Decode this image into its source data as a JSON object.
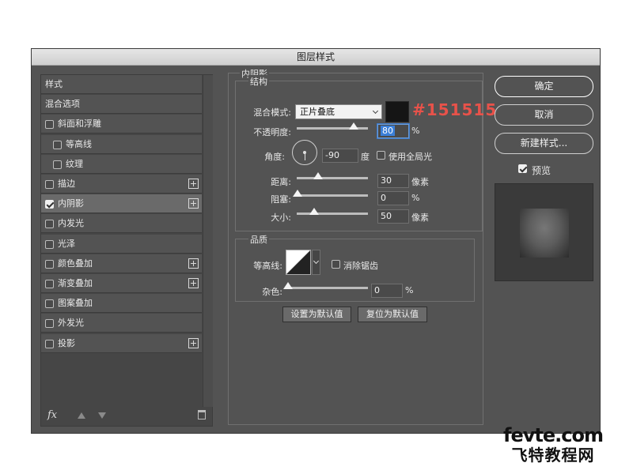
{
  "dialog": {
    "title": "图层样式"
  },
  "styles_list": {
    "items": [
      {
        "label": "样式",
        "checkbox": false,
        "checked": false,
        "plus": false,
        "indent": 0
      },
      {
        "label": "混合选项",
        "checkbox": false,
        "checked": false,
        "plus": false,
        "indent": 0
      },
      {
        "label": "斜面和浮雕",
        "checkbox": true,
        "checked": false,
        "plus": false,
        "indent": 0
      },
      {
        "label": "等高线",
        "checkbox": true,
        "checked": false,
        "plus": false,
        "indent": 1
      },
      {
        "label": "纹理",
        "checkbox": true,
        "checked": false,
        "plus": false,
        "indent": 1
      },
      {
        "label": "描边",
        "checkbox": true,
        "checked": false,
        "plus": true,
        "indent": 0
      },
      {
        "label": "内阴影",
        "checkbox": true,
        "checked": true,
        "plus": true,
        "indent": 0,
        "active": true
      },
      {
        "label": "内发光",
        "checkbox": true,
        "checked": false,
        "plus": false,
        "indent": 0
      },
      {
        "label": "光泽",
        "checkbox": true,
        "checked": false,
        "plus": false,
        "indent": 0
      },
      {
        "label": "颜色叠加",
        "checkbox": true,
        "checked": false,
        "plus": true,
        "indent": 0
      },
      {
        "label": "渐变叠加",
        "checkbox": true,
        "checked": false,
        "plus": true,
        "indent": 0
      },
      {
        "label": "图案叠加",
        "checkbox": true,
        "checked": false,
        "plus": false,
        "indent": 0
      },
      {
        "label": "外发光",
        "checkbox": true,
        "checked": false,
        "plus": false,
        "indent": 0
      },
      {
        "label": "投影",
        "checkbox": true,
        "checked": false,
        "plus": true,
        "indent": 0
      }
    ],
    "footer": {
      "fx_label": "fx"
    }
  },
  "inner_shadow": {
    "section_title": "内阴影",
    "structure": {
      "title": "结构",
      "blend_mode_label": "混合模式:",
      "blend_mode_value": "正片叠底",
      "color_hex": "#151515",
      "opacity_label": "不透明度:",
      "opacity_value": "80",
      "opacity_unit": "%",
      "angle_label": "角度:",
      "angle_value": "-90",
      "angle_unit": "度",
      "global_light_label": "使用全局光",
      "distance_label": "距离:",
      "distance_value": "30",
      "distance_unit": "像素",
      "choke_label": "阻塞:",
      "choke_value": "0",
      "choke_unit": "%",
      "size_label": "大小:",
      "size_value": "50",
      "size_unit": "像素"
    },
    "quality": {
      "title": "品质",
      "contour_label": "等高线:",
      "anti_alias_label": "消除锯齿",
      "noise_label": "杂色:",
      "noise_value": "0",
      "noise_unit": "%"
    },
    "buttons": {
      "make_default": "设置为默认值",
      "reset_default": "复位为默认值"
    }
  },
  "right_panel": {
    "ok": "确定",
    "cancel": "取消",
    "new_style": "新建样式...",
    "preview_label": "预览"
  },
  "watermark": {
    "line1": "fevte.com",
    "line2": "飞特教程网"
  },
  "colors": {
    "shadow_color": "#151515",
    "annotation": "#e8524a",
    "panel_bg": "#535353"
  }
}
